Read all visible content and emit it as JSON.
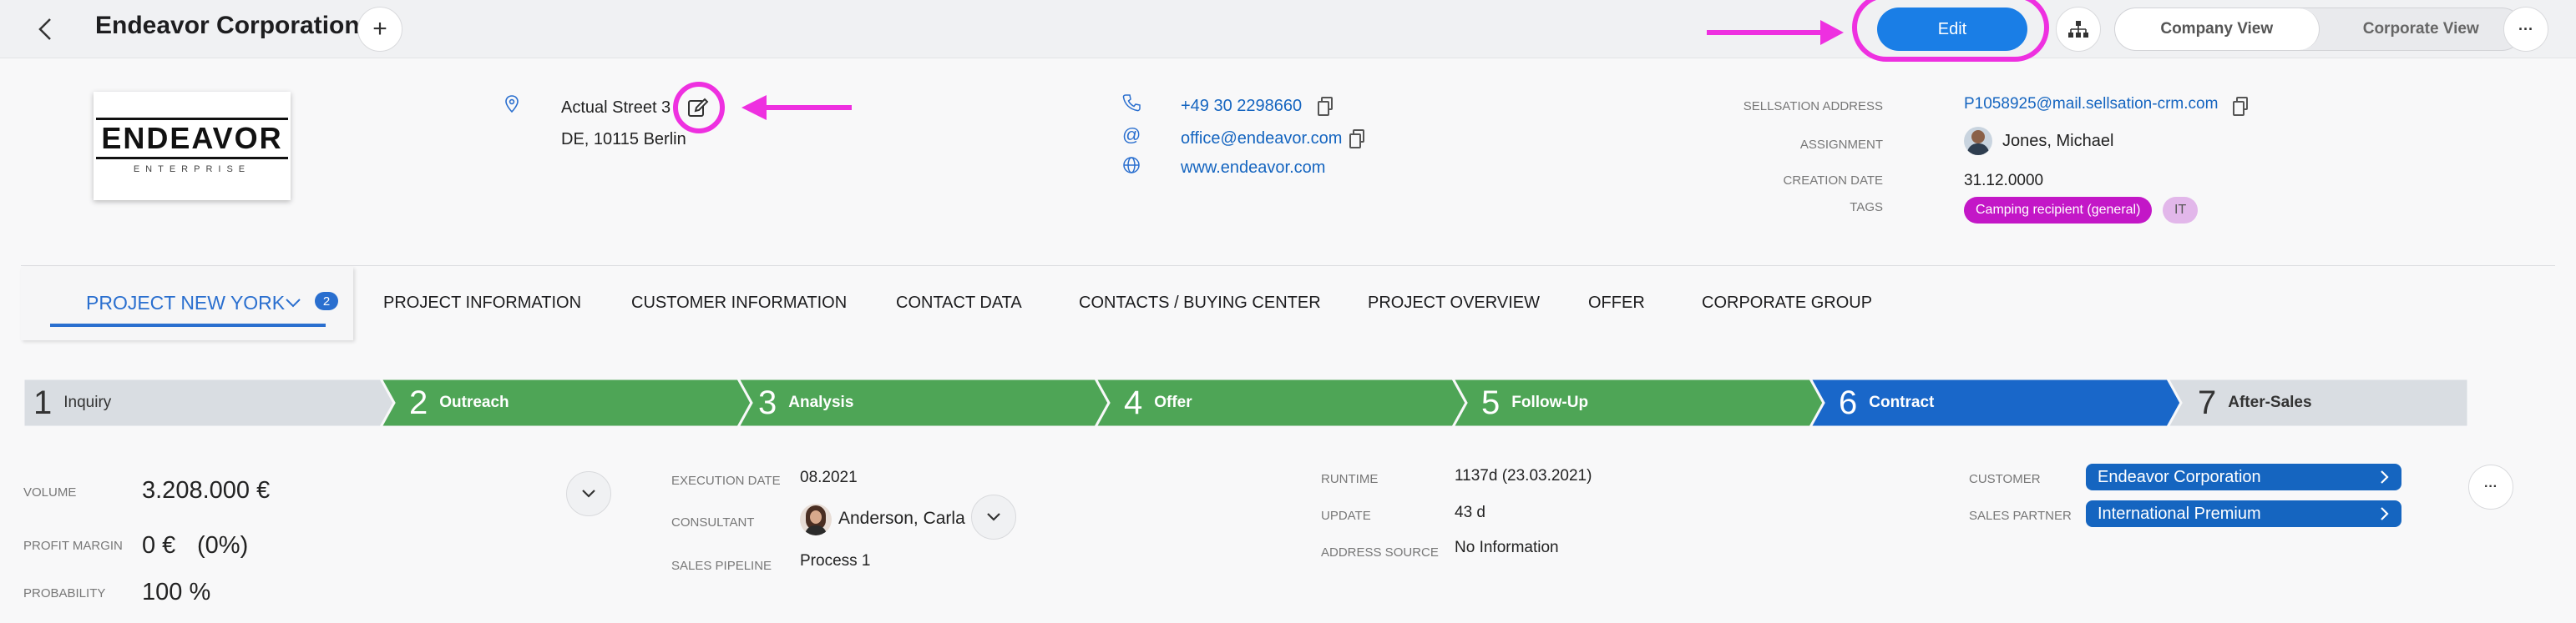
{
  "header": {
    "title": "Endeavor Corporation",
    "edit_label": "Edit",
    "company_view_label": "Company View",
    "corporate_view_label": "Corporate View",
    "more_label": "···"
  },
  "company": {
    "logo_main": "ENDEAVOR",
    "logo_sub": "ENTERPRISE",
    "address_line1": "Actual Street 3",
    "address_line2": "DE, 10115 Berlin",
    "phone": "+49 30 2298660",
    "email": "office@endeavor.com",
    "website": "www.endeavor.com",
    "sellsation_address_label": "SELLSATION ADDRESS",
    "sellsation_address": "P1058925@mail.sellsation-crm.com",
    "assignment_label": "ASSIGNMENT",
    "assignment": "Jones, Michael",
    "creation_date_label": "CREATION DATE",
    "creation_date": "31.12.0000",
    "tags_label": "TAGS",
    "tags": [
      "Camping recipient (general)",
      "IT"
    ]
  },
  "tabs": {
    "project_label": "PROJECT NEW YORK",
    "project_count": "2",
    "items": [
      "PROJECT INFORMATION",
      "CUSTOMER INFORMATION",
      "CONTACT DATA",
      "CONTACTS / BUYING CENTER",
      "PROJECT OVERVIEW",
      "OFFER",
      "CORPORATE GROUP"
    ]
  },
  "pipeline": [
    {
      "num": "1",
      "name": "Inquiry",
      "status": "todo"
    },
    {
      "num": "2",
      "name": "Outreach",
      "status": "done"
    },
    {
      "num": "3",
      "name": "Analysis",
      "status": "done"
    },
    {
      "num": "4",
      "name": "Offer",
      "status": "done"
    },
    {
      "num": "5",
      "name": "Follow-Up",
      "status": "done"
    },
    {
      "num": "6",
      "name": "Contract",
      "status": "current"
    },
    {
      "num": "7",
      "name": "After-Sales",
      "status": "todo"
    }
  ],
  "colors": {
    "done": "#4ea556",
    "current": "#1967c9",
    "todo": "#d9dde2",
    "highlight": "#ee30e0"
  },
  "details": {
    "volume_label": "VOLUME",
    "volume": "3.208.000 €",
    "profit_label": "PROFIT MARGIN",
    "profit": "0 €",
    "profit_pct": "(0%)",
    "probability_label": "PROBABILITY",
    "probability": "100 %",
    "execution_label": "EXECUTION DATE",
    "execution": "08.2021",
    "consultant_label": "CONSULTANT",
    "consultant": "Anderson, Carla",
    "pipeline_label": "SALES PIPELINE",
    "pipeline_value": "Process 1",
    "runtime_label": "RUNTIME",
    "runtime": "1137d (23.03.2021)",
    "update_label": "UPDATE",
    "update": "43 d",
    "source_label": "ADDRESS SOURCE",
    "source": "No Information",
    "customer_label": "CUSTOMER",
    "customer": "Endeavor Corporation",
    "partner_label": "SALES PARTNER",
    "partner": "International Premium"
  }
}
